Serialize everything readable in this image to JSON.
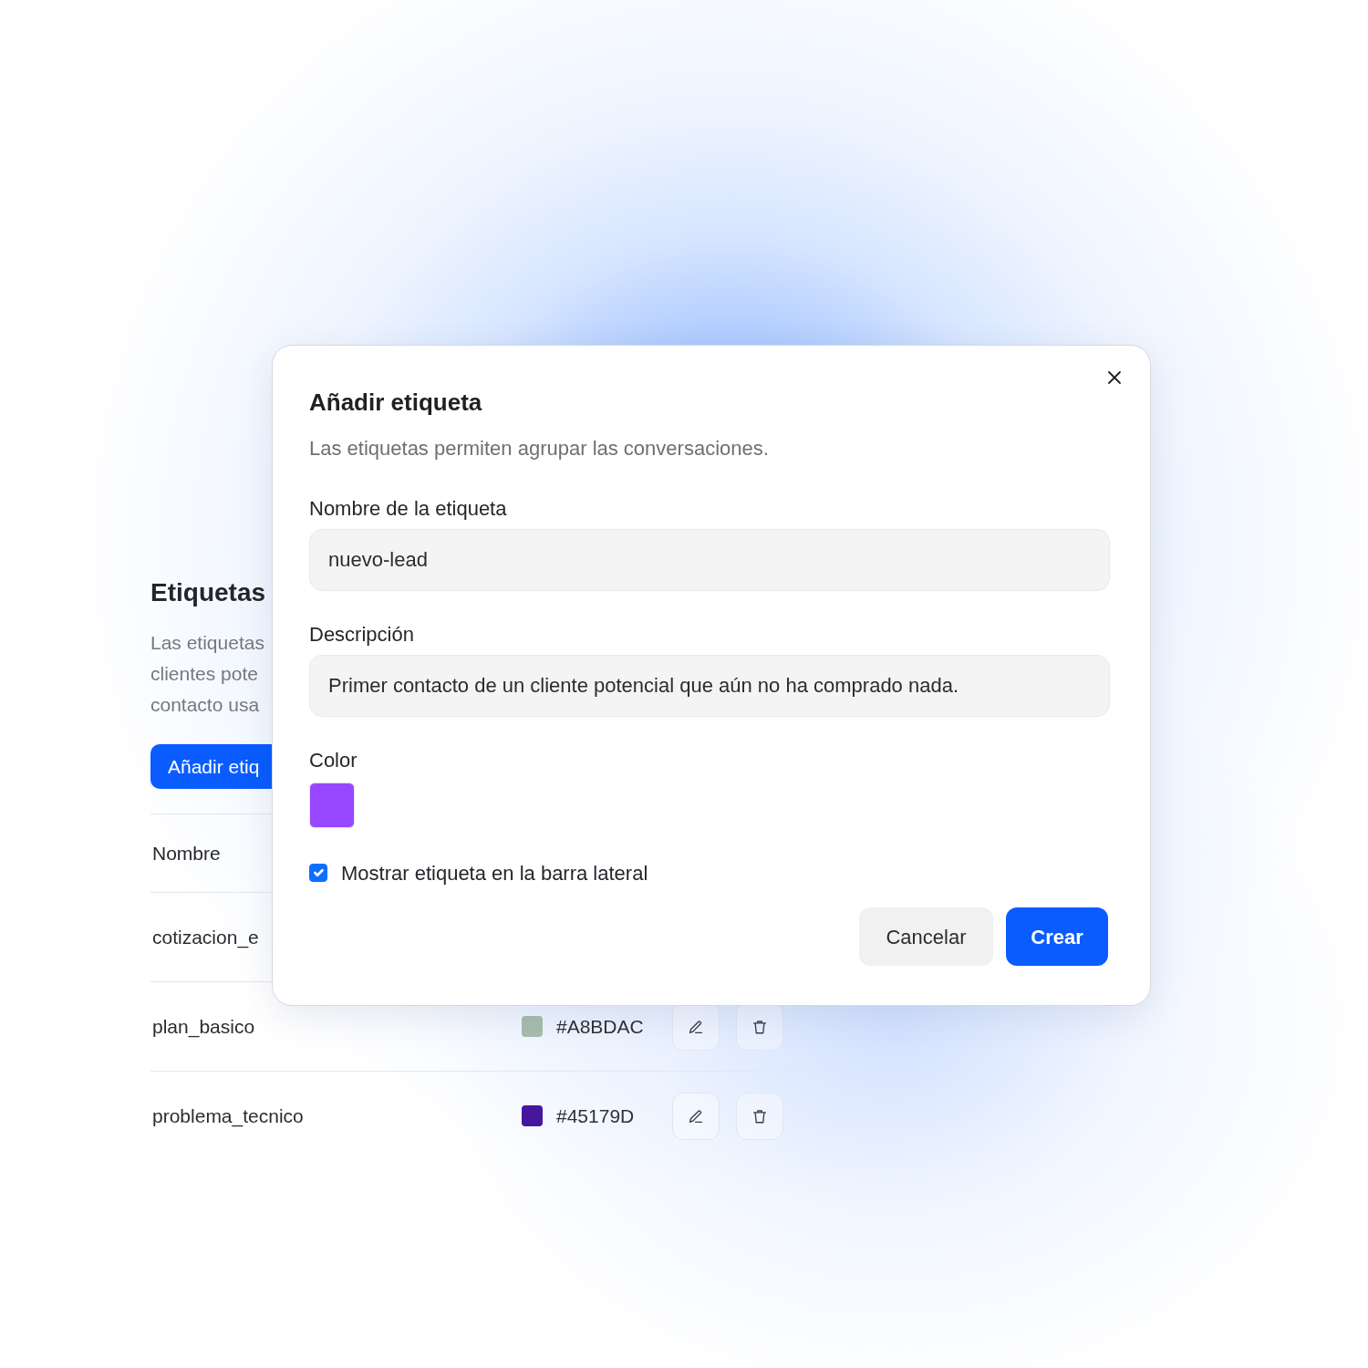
{
  "page": {
    "title": "Etiquetas",
    "description_lines": [
      "Las etiquetas",
      "clientes pote",
      "contacto usa"
    ],
    "add_button": "Añadir etiq",
    "table": {
      "columns": [
        "Nombre"
      ],
      "rows": [
        {
          "name": "cotizacion_e"
        },
        {
          "name": "plan_basico",
          "color": "#a8bdac",
          "hex": "#A8BDAC"
        },
        {
          "name": "problema_tecnico",
          "color": "#45179d",
          "hex": "#45179D"
        }
      ]
    }
  },
  "dialog": {
    "title": "Añadir etiqueta",
    "subtitle": "Las etiquetas permiten agrupar las conversaciones.",
    "fields": [
      {
        "label": "Nombre de la etiqueta",
        "value": "nuevo-lead"
      },
      {
        "label": "Descripción",
        "value": "Primer contacto de un cliente potencial que aún no ha comprado nada."
      }
    ],
    "color": {
      "label": "Color",
      "color": "#9747ff"
    },
    "checkbox": {
      "label": "Mostrar etiqueta en la barra lateral",
      "checked": true
    },
    "buttons": [
      {
        "label": "Cancelar",
        "kind": "secondary"
      },
      {
        "label": "Crear",
        "kind": "primary"
      }
    ]
  }
}
